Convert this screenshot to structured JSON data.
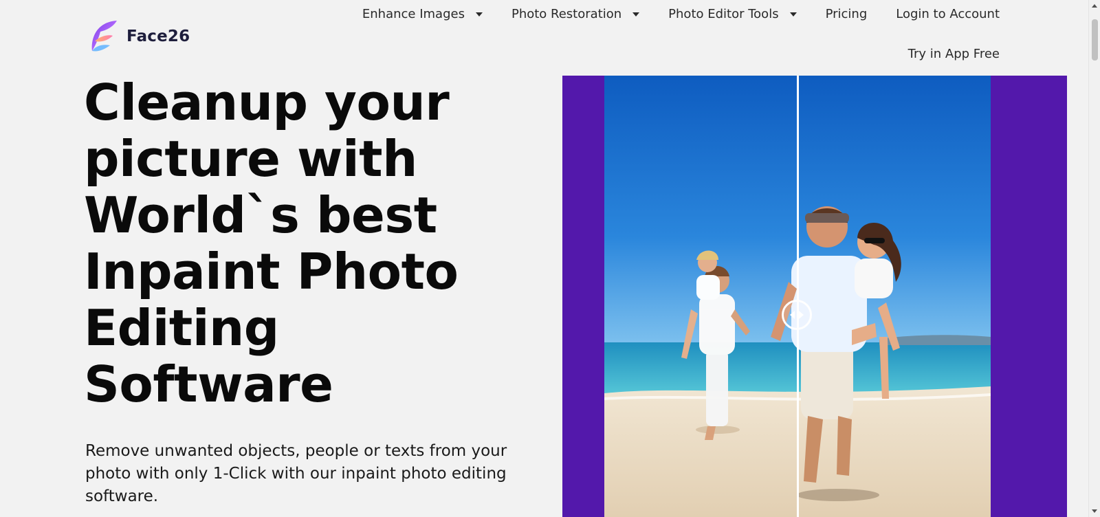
{
  "brand": {
    "name": "Face26"
  },
  "nav": {
    "items": [
      {
        "label": "Enhance Images",
        "dropdown": true
      },
      {
        "label": "Photo Restoration",
        "dropdown": true
      },
      {
        "label": "Photo Editor Tools",
        "dropdown": true
      },
      {
        "label": "Pricing",
        "dropdown": false
      },
      {
        "label": "Login to Account",
        "dropdown": false
      }
    ],
    "cta": "Try in App Free"
  },
  "hero": {
    "title": "Cleanup your picture with World`s best Inpaint Photo Editing Software",
    "subtitle": "Remove unwanted objects, people or texts from your photo with only 1-Click with our inpaint photo editing software."
  },
  "comparison": {
    "handle_icon": "slider-handle-icon",
    "slider_position_fraction": 0.5
  },
  "colors": {
    "background": "#f2f2f2",
    "media_frame": "#5318ab",
    "sky": "#1b6fcf",
    "sea": "#2aa7c9",
    "sand": "#e9dcc6",
    "divider": "#ffffff",
    "brand_text": "#1e1e3c"
  }
}
